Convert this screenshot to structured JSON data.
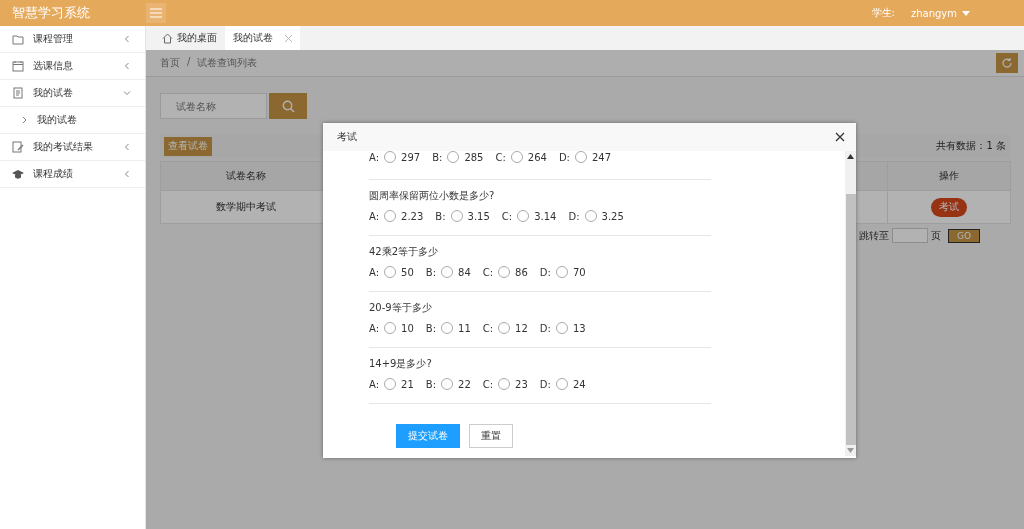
{
  "app": {
    "title": "智慧学习系统",
    "user_label": "学生:",
    "user_name": "zhangym"
  },
  "sidebar": {
    "items": [
      {
        "label": "课程管理",
        "kind": "folder",
        "expanded": false
      },
      {
        "label": "选课信息",
        "kind": "calendar",
        "expanded": false
      },
      {
        "label": "我的试卷",
        "kind": "document",
        "expanded": true,
        "children": [
          {
            "label": "我的试卷"
          }
        ]
      },
      {
        "label": "我的考试结果",
        "kind": "edit",
        "expanded": false
      },
      {
        "label": "课程成绩",
        "kind": "cap",
        "expanded": false
      }
    ]
  },
  "tabs": [
    {
      "label": "我的桌面",
      "kind": "home",
      "selected": false
    },
    {
      "label": "我的试卷",
      "kind": "closable",
      "selected": true
    }
  ],
  "breadcrumb": {
    "separator": "/",
    "items": [
      "首页",
      "试卷查询列表"
    ]
  },
  "search": {
    "placeholder": "试卷名称"
  },
  "view_button": "查看试卷",
  "total": "共有数据：1 条",
  "table": {
    "columns": [
      "试卷名称",
      "操作"
    ],
    "rows": [
      {
        "name": "数学期中考试",
        "action": "考试"
      }
    ]
  },
  "pager": {
    "jump_label": "跳转至",
    "page_label": "页",
    "go": "GO"
  },
  "modal": {
    "title": "考试",
    "questions": [
      {
        "options": [
          {
            "letter": "A:",
            "value": "297",
            "selected": false
          },
          {
            "letter": "B:",
            "value": "285",
            "selected": false
          },
          {
            "letter": "C:",
            "value": "264",
            "selected": false
          },
          {
            "letter": "D:",
            "value": "247",
            "selected": false
          }
        ]
      },
      {
        "title": "圆周率保留两位小数是多少?",
        "options": [
          {
            "letter": "A:",
            "value": "2.23",
            "selected": false
          },
          {
            "letter": "B:",
            "value": "3.15",
            "selected": false
          },
          {
            "letter": "C:",
            "value": "3.14",
            "selected": false
          },
          {
            "letter": "D:",
            "value": "3.25",
            "selected": false
          }
        ]
      },
      {
        "title": "42乘2等于多少",
        "options": [
          {
            "letter": "A:",
            "value": "50",
            "selected": false
          },
          {
            "letter": "B:",
            "value": "84",
            "selected": false
          },
          {
            "letter": "C:",
            "value": "86",
            "selected": false
          },
          {
            "letter": "D:",
            "value": "70",
            "selected": false
          }
        ]
      },
      {
        "title": "20-9等于多少",
        "options": [
          {
            "letter": "A:",
            "value": "10",
            "selected": false
          },
          {
            "letter": "B:",
            "value": "11",
            "selected": false
          },
          {
            "letter": "C:",
            "value": "12",
            "selected": false
          },
          {
            "letter": "D:",
            "value": "13",
            "selected": false
          }
        ]
      },
      {
        "title": "14+9是多少?",
        "options": [
          {
            "letter": "A:",
            "value": "21",
            "selected": false
          },
          {
            "letter": "B:",
            "value": "22",
            "selected": false
          },
          {
            "letter": "C:",
            "value": "23",
            "selected": false
          },
          {
            "letter": "D:",
            "value": "24",
            "selected": false
          }
        ]
      }
    ],
    "submit": "提交试卷",
    "reset": "重置"
  }
}
